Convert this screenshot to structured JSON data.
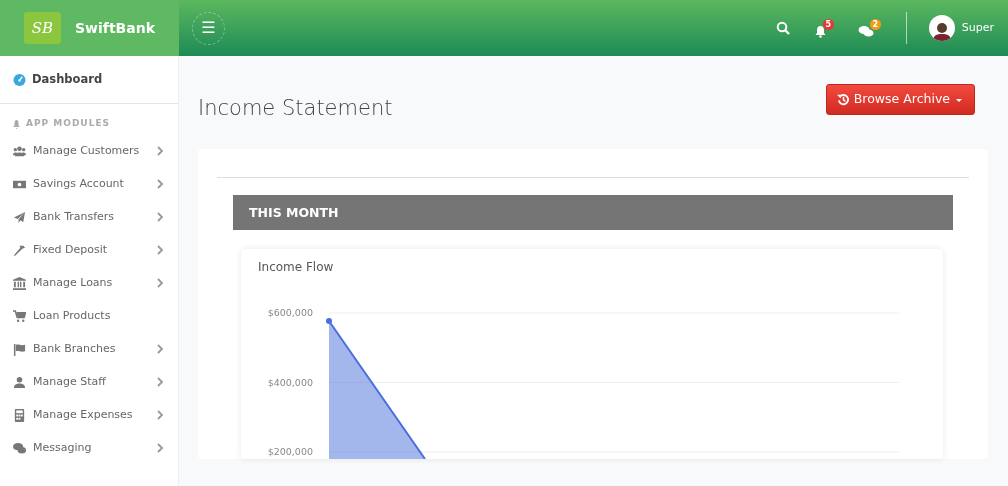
{
  "brand": {
    "name": "SwiftBank",
    "logo_text": "SB"
  },
  "topbar": {
    "menu_icon": "☰",
    "notifications_badge": "5",
    "messages_badge": "2",
    "user_name": "Super"
  },
  "sidebar": {
    "dashboard": "Dashboard",
    "section_title": "APP MODULES",
    "items": [
      {
        "label": "Manage Customers",
        "kind": "users",
        "has_submenu": true
      },
      {
        "label": "Savings Account",
        "kind": "money",
        "has_submenu": true
      },
      {
        "label": "Bank Transfers",
        "kind": "plane",
        "has_submenu": true
      },
      {
        "label": "Fixed Deposit",
        "kind": "hammer",
        "has_submenu": true
      },
      {
        "label": "Manage Loans",
        "kind": "bank",
        "has_submenu": true
      },
      {
        "label": "Loan Products",
        "kind": "cart",
        "has_submenu": false
      },
      {
        "label": "Bank Branches",
        "kind": "flag",
        "has_submenu": true
      },
      {
        "label": "Manage Staff",
        "kind": "user",
        "has_submenu": true
      },
      {
        "label": "Manage Expenses",
        "kind": "calculator",
        "has_submenu": true
      },
      {
        "label": "Messaging",
        "kind": "comments",
        "has_submenu": true
      }
    ]
  },
  "page": {
    "title": "Income Statement",
    "archive_button": "Browse Archive",
    "section_header": "THIS MONTH",
    "chart_card": {
      "title": "Income Flow",
      "axis_labels": [
        "$600,000",
        "$400,000",
        "$200,000"
      ]
    }
  }
}
